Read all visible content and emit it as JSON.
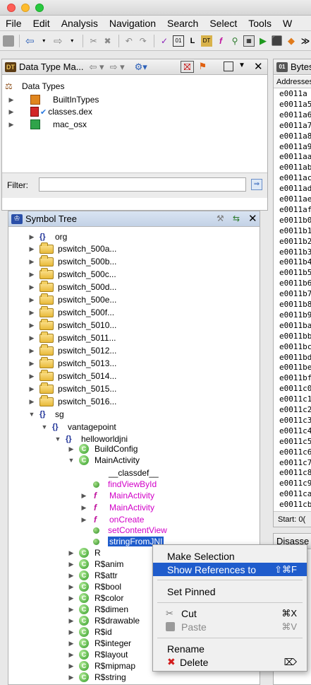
{
  "menu": [
    "File",
    "Edit",
    "Analysis",
    "Navigation",
    "Search",
    "Select",
    "Tools",
    "W"
  ],
  "data_type_panel": {
    "title": "Data Type Ma...",
    "tree": [
      "Data Types",
      "BuiltInTypes",
      "classes.dex",
      "mac_osx"
    ],
    "filter_label": "Filter:",
    "filter_value": ""
  },
  "bytes_panel": {
    "title": "Bytes",
    "header": "Addresses",
    "rows": [
      "e0011a",
      "e0011a5",
      "e0011a6",
      "e0011a7",
      "e0011a8",
      "e0011a9",
      "e0011aa",
      "e0011ab",
      "e0011ac",
      "e0011ad",
      "e0011ae",
      "e0011af",
      "e0011b0",
      "e0011b1",
      "e0011b2",
      "e0011b3",
      "e0011b4",
      "e0011b5",
      "e0011b6",
      "e0011b7",
      "e0011b8",
      "e0011b9",
      "e0011ba",
      "e0011bb",
      "e0011bc",
      "e0011bd",
      "e0011be",
      "e0011bf",
      "e0011c0",
      "e0011c1",
      "e0011c2",
      "e0011c3",
      "e0011c4",
      "e0011c5",
      "e0011c6",
      "e0011c7",
      "e0011c8",
      "e0011c9",
      "e0011ca",
      "e0011cb"
    ],
    "start_label": "Start: 0("
  },
  "disasm_title": "Disasse",
  "symbol_tree": {
    "title": "Symbol Tree",
    "top": [
      "org",
      "pswitch_500a...",
      "pswitch_500b...",
      "pswitch_500c...",
      "pswitch_500d...",
      "pswitch_500e...",
      "pswitch_500f...",
      "pswitch_5010...",
      "pswitch_5011...",
      "pswitch_5012...",
      "pswitch_5013...",
      "pswitch_5014...",
      "pswitch_5015...",
      "pswitch_5016..."
    ],
    "sg": "sg",
    "vantagepoint": "vantagepoint",
    "helloworldjni": "helloworldjni",
    "buildconfig": "BuildConfig",
    "mainactivity": "MainActivity",
    "members": [
      "__classdef__",
      "findViewById",
      "MainActivity",
      "MainActivity",
      "onCreate",
      "setContentView",
      "stringFromJNI"
    ],
    "r_classes": [
      "R",
      "R$anim",
      "R$attr",
      "R$bool",
      "R$color",
      "R$dimen",
      "R$drawable",
      "R$id",
      "R$integer",
      "R$layout",
      "R$mipmap",
      "R$string"
    ]
  },
  "context_menu": {
    "make_selection": "Make Selection",
    "show_references": "Show References to",
    "show_references_sc": "⇧⌘F",
    "set_pinned": "Set Pinned",
    "cut": "Cut",
    "cut_sc": "⌘X",
    "paste": "Paste",
    "paste_sc": "⌘V",
    "rename": "Rename",
    "delete": "Delete",
    "delete_sc": "⌦"
  },
  "colors": {
    "selection": "#1f5ccc",
    "function_text": "#d200c8"
  }
}
